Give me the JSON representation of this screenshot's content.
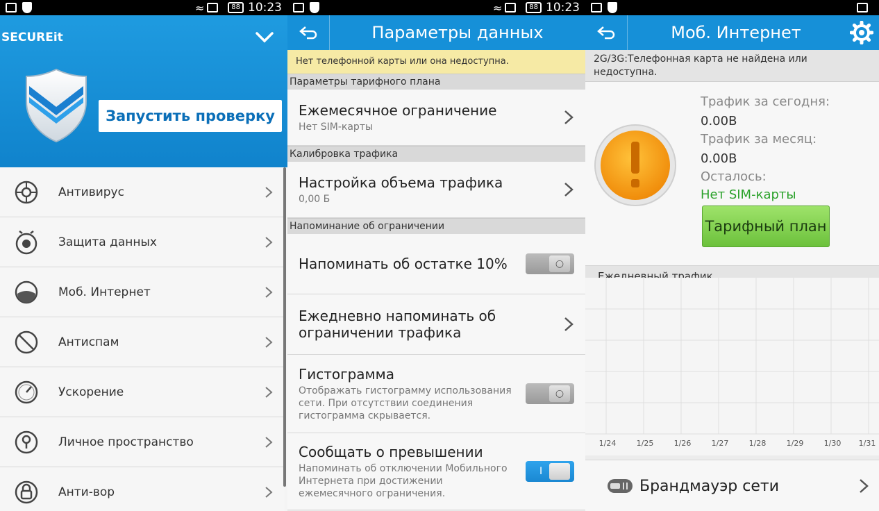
{
  "screen1": {
    "status": {
      "time": "10:23",
      "battery": "88"
    },
    "app_title": "SECUREit",
    "scan_button": "Запустить проверку",
    "items": [
      {
        "label": "Антивирус",
        "icon": "virus-icon"
      },
      {
        "label": "Защита данных",
        "icon": "eye-icon"
      },
      {
        "label": "Моб. Интернет",
        "icon": "data-icon"
      },
      {
        "label": "Антиспам",
        "icon": "block-icon"
      },
      {
        "label": "Ускорение",
        "icon": "speedometer-icon"
      },
      {
        "label": "Личное пространство",
        "icon": "keyhole-icon"
      },
      {
        "label": "Анти-вор",
        "icon": "lock-icon"
      }
    ]
  },
  "screen2": {
    "status": {
      "time": "10:23",
      "battery": "88"
    },
    "title": "Параметры данных",
    "notice": "Нет телефонной карты или она недоступна.",
    "sections": {
      "tariff": "Параметры тарифного плана",
      "calibration": "Калибровка трафика",
      "reminder": "Напоминание об ограничении"
    },
    "monthly_limit": {
      "title": "Ежемесячное ограничение",
      "subtitle": "Нет SIM-карты"
    },
    "traffic_setup": {
      "title": "Настройка объема трафика",
      "subtitle": "0,00 Б"
    },
    "remind_10": {
      "title": "Напоминать об остатке 10%",
      "on": false
    },
    "daily_remind": {
      "title": "Ежедневно напоминать об ограничении трафика"
    },
    "histogram": {
      "title": "Гистограмма",
      "subtitle": "Отображать гистограмму использования сети. При отсутствии соединения гистограмма скрывается.",
      "on": false
    },
    "exceed": {
      "title": "Сообщать о превышении",
      "subtitle": "Напоминать об отключении Мобильного Интернета при достижении ежемесячного ограничения.",
      "on": true
    }
  },
  "screen3": {
    "title": "Моб. Интернет",
    "notice": "2G/3G:Телефонная карта не найдена или недоступна.",
    "today_label": "Трафик за сегодня:",
    "today_value": "0.00B",
    "month_label": "Трафик за месяц:",
    "month_value": "0.00B",
    "left_label": "Осталось:",
    "left_value": "Нет SIM-карты",
    "plan_button": "Тарифный план",
    "daily_label": "Ежедневный трафик",
    "x_ticks": [
      "1/24",
      "1/25",
      "1/26",
      "1/27",
      "1/28",
      "1/29",
      "1/30",
      "1/31"
    ],
    "firewall": "Брандмауэр сети"
  },
  "colors": {
    "accent": "#1690d8",
    "warning_orange": "#f39a12",
    "green": "#6cc13c",
    "notice_yellow": "#f6eaa5"
  }
}
